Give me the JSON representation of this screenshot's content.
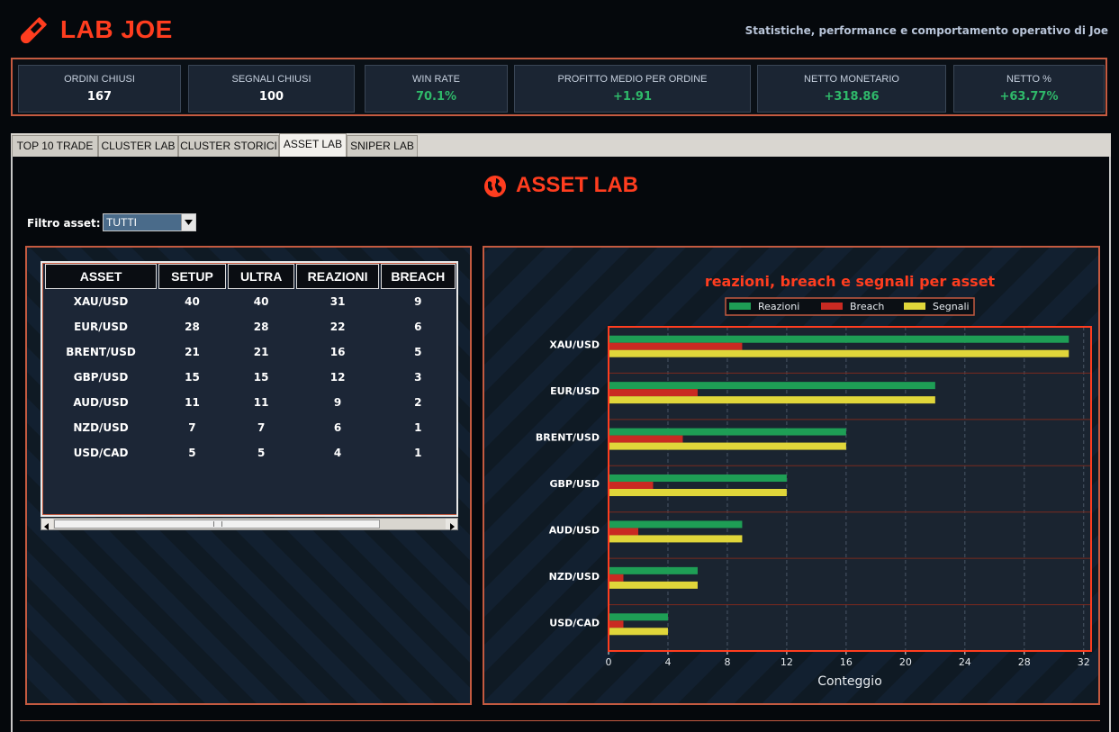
{
  "header": {
    "app_title": "LAB JOE",
    "tagline": "Statistiche, performance e comportamento operativo di Joe",
    "brand_color": "#ff3d1f"
  },
  "kpis": [
    {
      "label": "ORDINI CHIUSI",
      "value": "167"
    },
    {
      "label": "SEGNALI CHIUSI",
      "value": "100"
    },
    {
      "label": "WIN RATE",
      "value": "70.1%"
    },
    {
      "label": "PROFITTO MEDIO PER ORDINE",
      "value": "+1.91"
    },
    {
      "label": "NETTO MONETARIO",
      "value": "+318.86"
    },
    {
      "label": "NETTO %",
      "value": "+63.77%"
    }
  ],
  "tabs": [
    {
      "label": "TOP 10 TRADE"
    },
    {
      "label": "CLUSTER LAB"
    },
    {
      "label": "CLUSTER STORICI"
    },
    {
      "label": "ASSET LAB"
    },
    {
      "label": "SNIPER LAB"
    }
  ],
  "active_tab": "ASSET LAB",
  "section": {
    "title": "ASSET LAB",
    "filter_label": "Filtro asset:",
    "filter_value": "TUTTI"
  },
  "table": {
    "columns": [
      "ASSET",
      "SETUP",
      "ULTRA",
      "REAZIONI",
      "BREACH"
    ],
    "rows": [
      [
        "XAU/USD",
        "40",
        "40",
        "31",
        "9"
      ],
      [
        "EUR/USD",
        "28",
        "28",
        "22",
        "6"
      ],
      [
        "BRENT/USD",
        "21",
        "21",
        "16",
        "5"
      ],
      [
        "GBP/USD",
        "15",
        "15",
        "12",
        "3"
      ],
      [
        "AUD/USD",
        "11",
        "11",
        "9",
        "2"
      ],
      [
        "NZD/USD",
        "7",
        "7",
        "6",
        "1"
      ],
      [
        "USD/CAD",
        "5",
        "5",
        "4",
        "1"
      ]
    ]
  },
  "chart_data": {
    "type": "bar",
    "orientation": "horizontal",
    "title": "reazioni, breach e segnali per asset",
    "xlabel": "Conteggio",
    "ylabel": "",
    "categories": [
      "XAU/USD",
      "EUR/USD",
      "BRENT/USD",
      "GBP/USD",
      "AUD/USD",
      "NZD/USD",
      "USD/CAD"
    ],
    "series": [
      {
        "name": "Reazioni",
        "color": "#1e9e55",
        "values": [
          31,
          22,
          16,
          12,
          9,
          6,
          4
        ]
      },
      {
        "name": "Breach",
        "color": "#c92a22",
        "values": [
          9,
          6,
          5,
          3,
          2,
          1,
          1
        ]
      },
      {
        "name": "Segnali",
        "color": "#e0d63a",
        "values": [
          31,
          22,
          16,
          12,
          9,
          6,
          4
        ]
      }
    ],
    "xlim": [
      0,
      32.5
    ],
    "xticks": [
      0,
      4,
      8,
      12,
      16,
      20,
      24,
      28,
      32
    ],
    "grid": "vertical dashed",
    "legend": "top"
  }
}
